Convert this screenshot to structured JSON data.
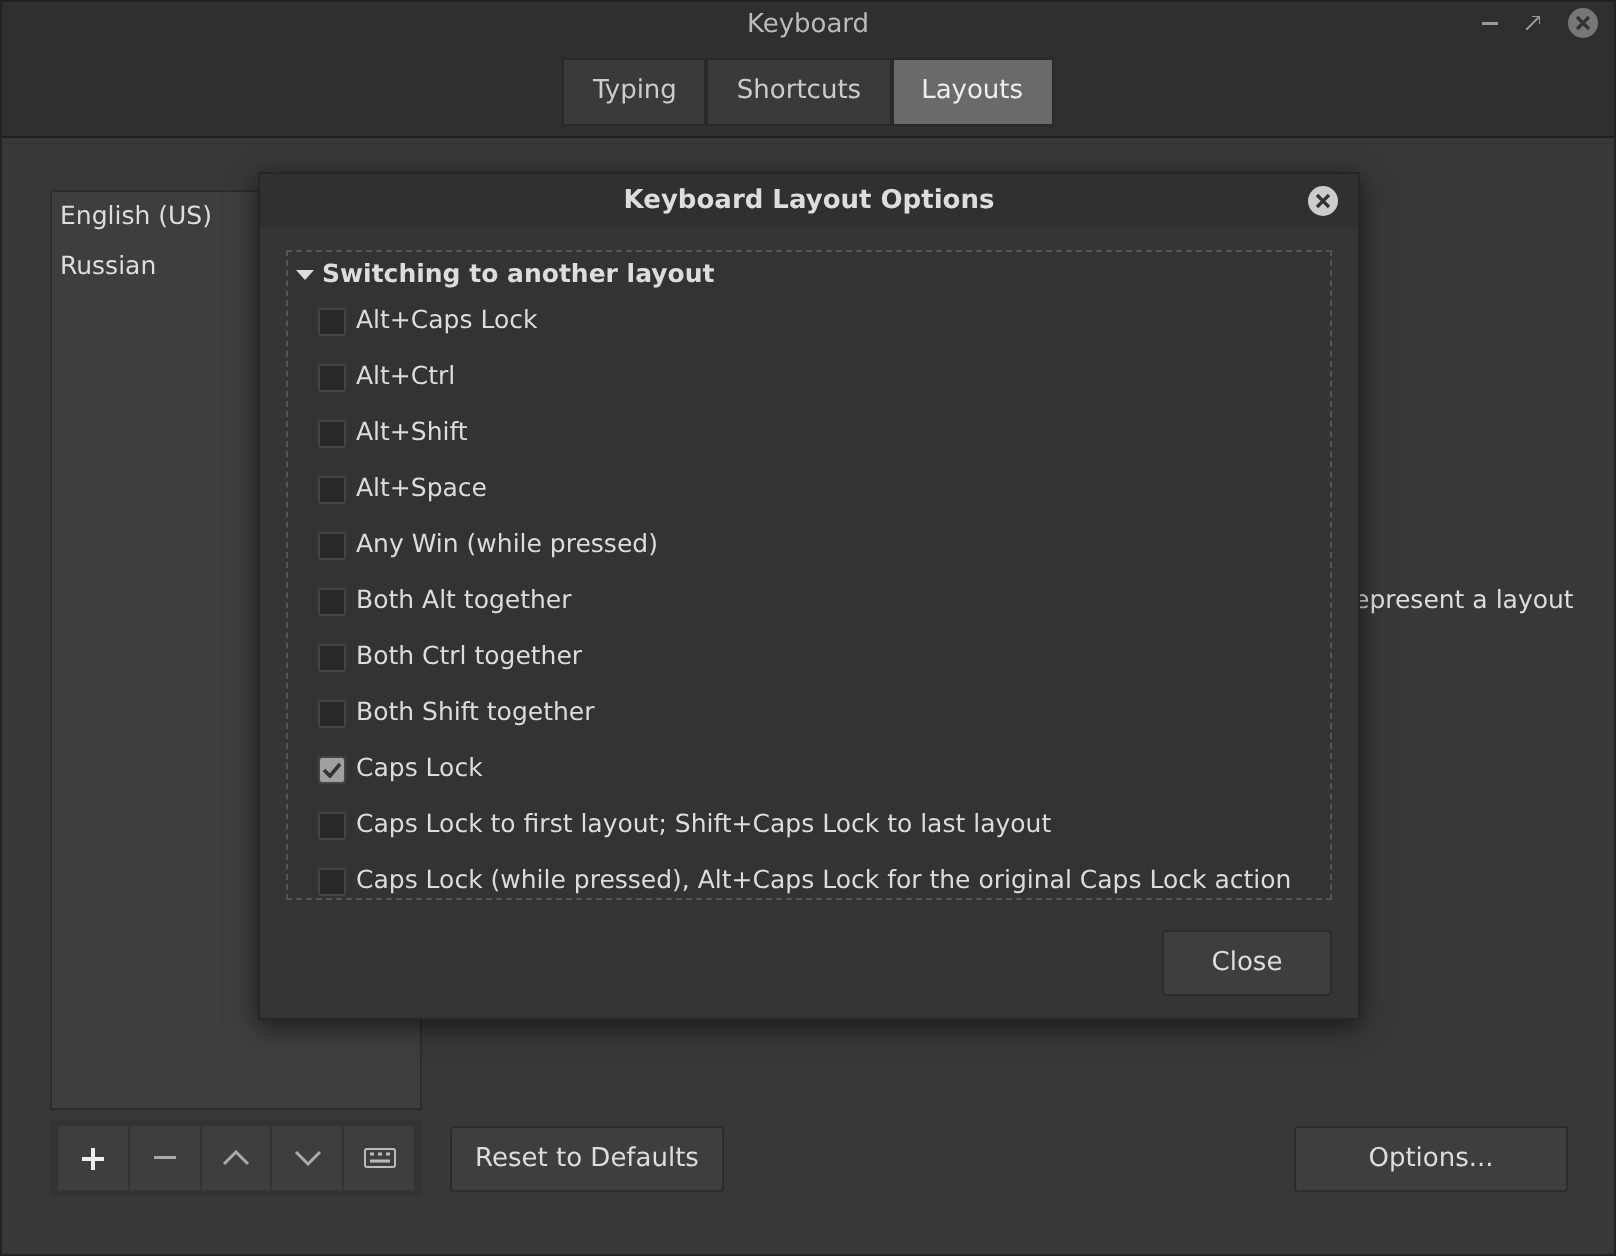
{
  "window": {
    "title": "Keyboard"
  },
  "tabs": [
    {
      "label": "Typing",
      "selected": false
    },
    {
      "label": "Shortcuts",
      "selected": false
    },
    {
      "label": "Layouts",
      "selected": true
    }
  ],
  "layouts": [
    {
      "label": "English (US)"
    },
    {
      "label": "Russian"
    }
  ],
  "description_fragment": "epresent a layout",
  "buttons": {
    "reset": "Reset to Defaults",
    "options": "Options..."
  },
  "dialog": {
    "title": "Keyboard Layout Options",
    "section": {
      "label": "Switching to another layout",
      "expanded": true,
      "options": [
        {
          "label": "Alt+Caps Lock",
          "checked": false
        },
        {
          "label": "Alt+Ctrl",
          "checked": false
        },
        {
          "label": "Alt+Shift",
          "checked": false
        },
        {
          "label": "Alt+Space",
          "checked": false
        },
        {
          "label": "Any Win (while pressed)",
          "checked": false
        },
        {
          "label": "Both Alt together",
          "checked": false
        },
        {
          "label": "Both Ctrl together",
          "checked": false
        },
        {
          "label": "Both Shift together",
          "checked": false
        },
        {
          "label": "Caps Lock",
          "checked": true
        },
        {
          "label": "Caps Lock to first layout; Shift+Caps Lock to last layout",
          "checked": false
        },
        {
          "label": "Caps Lock (while pressed), Alt+Caps Lock for the original Caps Lock action",
          "checked": false
        }
      ]
    },
    "close_button": "Close"
  }
}
